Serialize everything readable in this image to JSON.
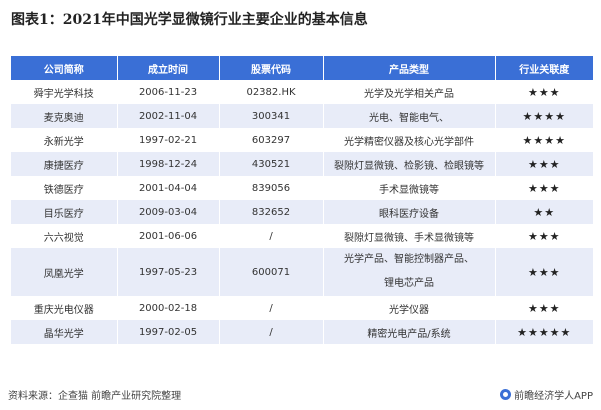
{
  "title": "图表1：2021年中国光学显微镜行业主要企业的基本信息",
  "table": {
    "headers": [
      "公司简称",
      "成立时间",
      "股票代码",
      "产品类型",
      "行业关联度"
    ],
    "rows": [
      [
        "舜宇光学科技",
        "2006-11-23",
        "02382.HK",
        "光学及光学相关产品",
        "★★★"
      ],
      [
        "麦克奥迪",
        "2002-11-04",
        "300341",
        "光电、智能电气、",
        "★★★★"
      ],
      [
        "永新光学",
        "1997-02-21",
        "603297",
        "光学精密仪器及核心光学部件",
        "★★★★"
      ],
      [
        "康捷医疗",
        "1998-12-24",
        "430521",
        "裂隙灯显微镜、检影镜、检眼镜等",
        "★★★"
      ],
      [
        "铁德医疗",
        "2001-04-04",
        "839056",
        "手术显微镜等",
        "★★★"
      ],
      [
        "目乐医疗",
        "2009-03-04",
        "832652",
        "眼科医疗设备",
        "★★"
      ],
      [
        "六六视觉",
        "2001-06-06",
        "/",
        "裂隙灯显微镜、手术显微镜等",
        "★★★"
      ],
      [
        "凤凰光学",
        "1997-05-23",
        "600071",
        "光学产品、智能控制器产品、",
        "★★★"
      ],
      [
        "重庆光电仪器",
        "2000-02-18",
        "/",
        "光学仪器",
        "★★★"
      ],
      [
        "晶华光学",
        "1997-02-05",
        "/",
        "精密光电产品/系统",
        "★★★★★"
      ]
    ],
    "row8_product_line2": "锂电芯产品"
  },
  "footer": {
    "source": "资料来源：企查猫 前瞻产业研究院整理",
    "brand": "前瞻经济学人APP"
  },
  "colors": {
    "header": "#3a6fd6",
    "stripe": "#e8ecf8"
  }
}
